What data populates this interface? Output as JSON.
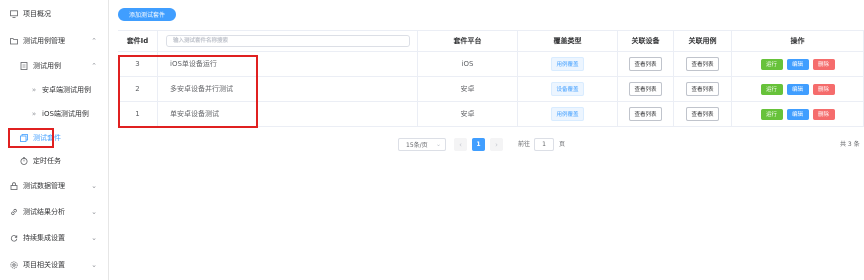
{
  "sidebar": {
    "items": [
      {
        "label": "项目概况",
        "icon": "monitor-icon",
        "arrow": ""
      },
      {
        "label": "测试用例管理",
        "icon": "folder-icon",
        "arrow": "^"
      },
      {
        "label": "测试用例",
        "icon": "document-icon",
        "arrow": "^"
      },
      {
        "label": "安卓端测试用例",
        "icon": "double-chevron-icon",
        "arrow": ""
      },
      {
        "label": "iOS端测试用例",
        "icon": "double-chevron-icon",
        "arrow": ""
      },
      {
        "label": "测试套件",
        "icon": "copy-icon",
        "arrow": ""
      },
      {
        "label": "定时任务",
        "icon": "timer-icon",
        "arrow": ""
      },
      {
        "label": "测试数据管理",
        "icon": "lock-icon",
        "arrow": "v"
      },
      {
        "label": "测试结果分析",
        "icon": "link-icon",
        "arrow": "v"
      },
      {
        "label": "持续集成设置",
        "icon": "refresh-icon",
        "arrow": "v"
      },
      {
        "label": "项目相关设置",
        "icon": "gear-icon",
        "arrow": "v"
      }
    ]
  },
  "toolbar": {
    "add_label": "添加测试套件"
  },
  "table": {
    "headers": {
      "id": "套件Id",
      "platform": "套件平台",
      "coverage": "覆盖类型",
      "devices": "关联设备",
      "cases": "关联用例",
      "ops": "操作"
    },
    "search_placeholder": "输入测试套件名称搜索",
    "rows": [
      {
        "id": "3",
        "name": "iOS单设备运行",
        "platform": "iOS",
        "coverage": "用例覆盖",
        "devices": "查看列表",
        "cases": "查看列表",
        "run": "运行",
        "edit": "编辑",
        "delete": "删除"
      },
      {
        "id": "2",
        "name": "多安卓设备并行测试",
        "platform": "安卓",
        "coverage": "设备覆盖",
        "devices": "查看列表",
        "cases": "查看列表",
        "run": "运行",
        "edit": "编辑",
        "delete": "删除"
      },
      {
        "id": "1",
        "name": "单安卓设备测试",
        "platform": "安卓",
        "coverage": "用例覆盖",
        "devices": "查看列表",
        "cases": "查看列表",
        "run": "运行",
        "edit": "编辑",
        "delete": "删除"
      }
    ]
  },
  "pagination": {
    "page_size": "15条/页",
    "current_page": "1",
    "goto_prefix": "前往",
    "goto_value": "1",
    "goto_suffix": "页",
    "total": "共 3 条"
  },
  "colors": {
    "primary": "#409eff",
    "success": "#67c23a",
    "danger": "#f56c6c",
    "highlight": "#e02020"
  }
}
